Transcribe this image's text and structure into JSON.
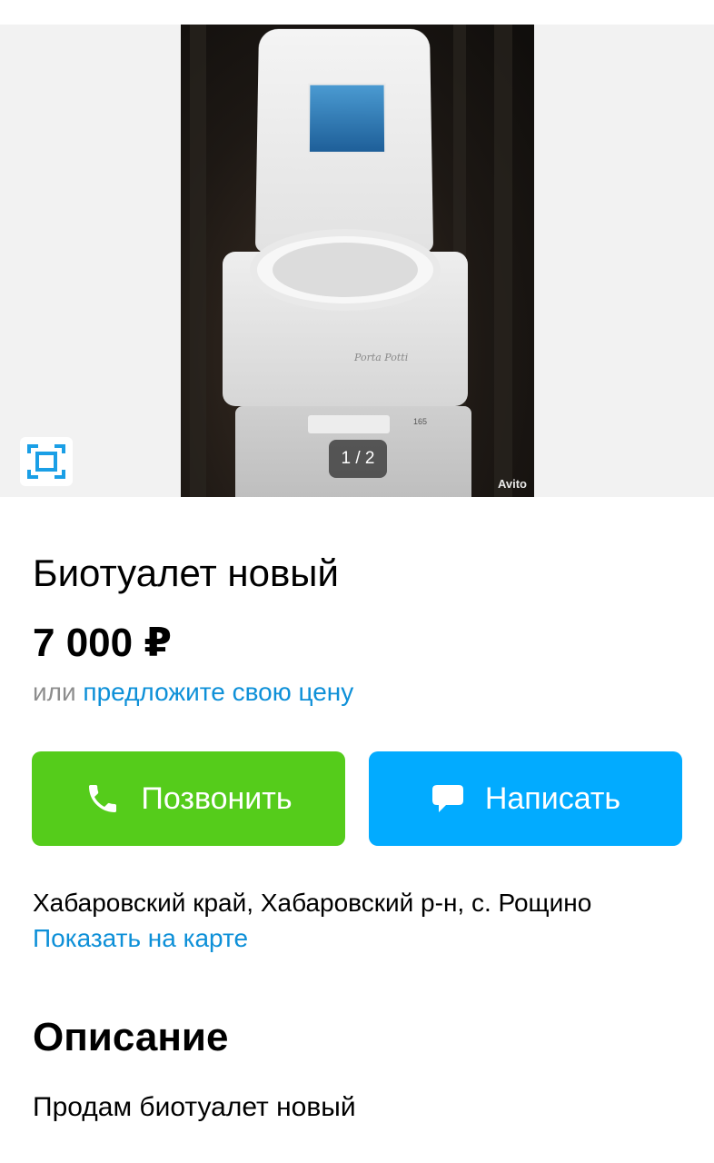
{
  "gallery": {
    "counter": "1 / 2",
    "watermark": "Avito",
    "fullscreen_icon": "expand-frame-icon"
  },
  "listing": {
    "title": "Биотуалет новый",
    "price": "7 000 ₽",
    "offer_prefix": "или ",
    "offer_link": "предложите свою цену"
  },
  "actions": {
    "call_label": "Позвонить",
    "call_icon": "phone-icon",
    "call_color": "#55cc1b",
    "write_label": "Написать",
    "write_icon": "chat-bubble-icon",
    "write_color": "#02abff"
  },
  "location": {
    "address": "Хабаровский край, Хабаровский р-н, с. Рощино",
    "map_link": "Показать на карте"
  },
  "description": {
    "heading": "Описание",
    "text": "Продам биотуалет новый"
  },
  "colors": {
    "link": "#0e90d8",
    "muted": "#8d8d8d"
  }
}
